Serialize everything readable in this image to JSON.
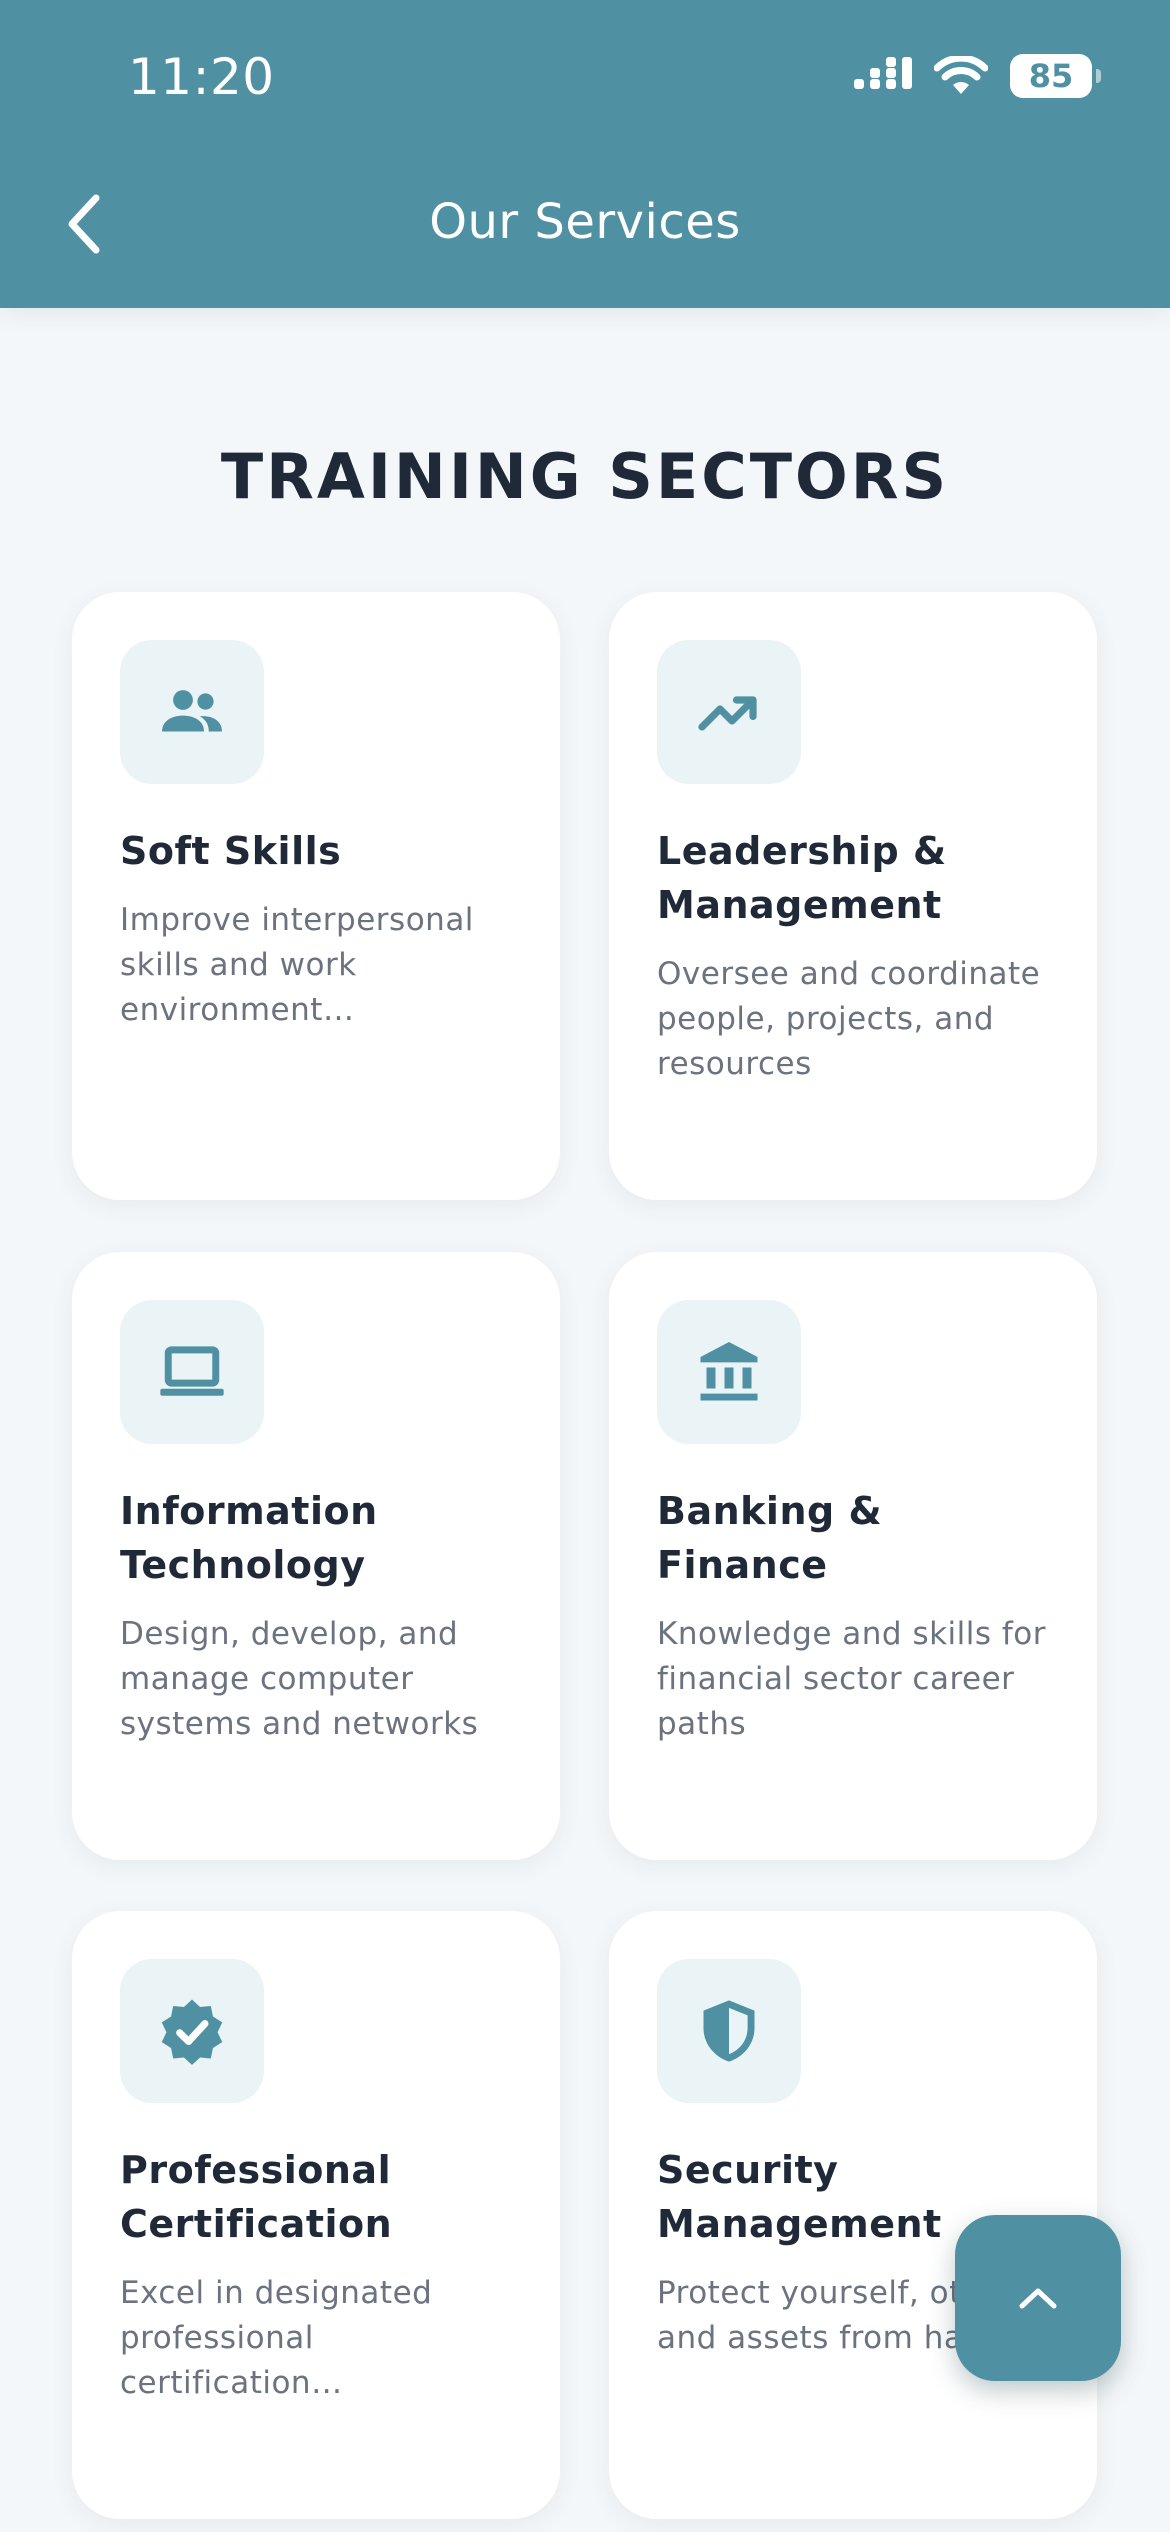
{
  "status_bar": {
    "time": "11:20",
    "battery": "85"
  },
  "header": {
    "title": "Our Services",
    "back_icon": "chevron-left-icon"
  },
  "section": {
    "title": "TRAINING SECTORS"
  },
  "cards": [
    {
      "title": "Soft Skills",
      "description": "Improve interpersonal skills and work environment effectiveness",
      "icon": "people-icon"
    },
    {
      "title": "Leadership & Management",
      "description": "Oversee and coordinate people, projects, and resources",
      "icon": "trending-up-icon"
    },
    {
      "title": "Information Technology",
      "description": "Design, develop, and manage computer systems and networks",
      "icon": "laptop-icon"
    },
    {
      "title": "Banking & Finance",
      "description": "Knowledge and skills for financial sector career paths",
      "icon": "bank-icon"
    },
    {
      "title": "Professional Certification",
      "description": "Excel in designated professional certification examinations",
      "icon": "verified-badge-icon"
    },
    {
      "title": "Security Management",
      "description": "Protect yourself, others, and assets from harm",
      "icon": "shield-icon"
    }
  ],
  "fab": {
    "icon": "chevron-up-icon"
  },
  "colors": {
    "primary": "#4F91A2",
    "background": "#F4F7F9",
    "icon_bg": "#EAF3F5",
    "title_text": "#1F2937",
    "body_text": "#6B7280"
  }
}
